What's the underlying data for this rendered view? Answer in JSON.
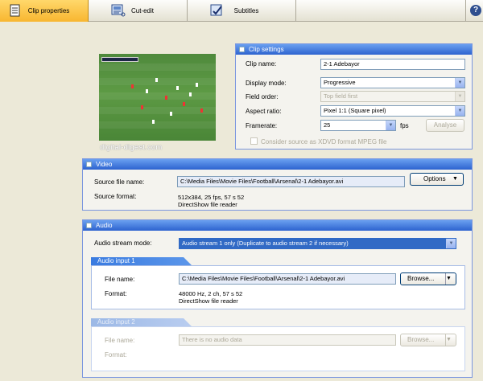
{
  "toolbar": {
    "tabs": [
      {
        "label": "Clip properties",
        "icon": "document-icon",
        "active": true
      },
      {
        "label": "Cut-edit",
        "icon": "film-cut-icon",
        "active": false
      },
      {
        "label": "Subtitles",
        "icon": "subtitle-icon",
        "active": false
      }
    ],
    "help": "?"
  },
  "preview": {
    "watermark": "digital-digest.com"
  },
  "clip_settings": {
    "title": "Clip settings",
    "clip_name_label": "Clip name:",
    "clip_name_value": "2-1 Adebayor",
    "display_mode_label": "Display mode:",
    "display_mode_value": "Progressive",
    "field_order_label": "Field order:",
    "field_order_value": "Top field first",
    "aspect_ratio_label": "Aspect ratio:",
    "aspect_ratio_value": "Pixel 1:1 (Square pixel)",
    "framerate_label": "Framerate:",
    "framerate_value": "25",
    "fps_label": "fps",
    "analyse_label": "Analyse",
    "xdvd_label": "Consider source as XDVD format MPEG file"
  },
  "video": {
    "title": "Video",
    "source_file_label": "Source file name:",
    "source_file_value": "C:\\Media Files\\Movie Files\\Football\\Arsenal\\2-1 Adebayor.avi",
    "options_label": "Options",
    "source_format_label": "Source format:",
    "source_format_line1": "512x384, 25 fps, 57 s 52",
    "source_format_line2": "DirectShow file reader"
  },
  "audio": {
    "title": "Audio",
    "stream_mode_label": "Audio stream mode:",
    "stream_mode_value": "Audio stream 1 only (Duplicate to audio stream 2 if necessary)",
    "input1": {
      "title": "Audio input 1",
      "file_name_label": "File name:",
      "file_name_value": "C:\\Media Files\\Movie Files\\Football\\Arsenal\\2-1 Adebayor.avi",
      "browse_label": "Browse...",
      "format_label": "Format:",
      "format_line1": "48000 Hz, 2 ch, 57 s 52",
      "format_line2": "DirectShow file reader"
    },
    "input2": {
      "title": "Audio input 2",
      "file_name_label": "File name:",
      "file_name_value": "There is no audio data",
      "browse_label": "Browse...",
      "format_label": "Format:"
    }
  }
}
